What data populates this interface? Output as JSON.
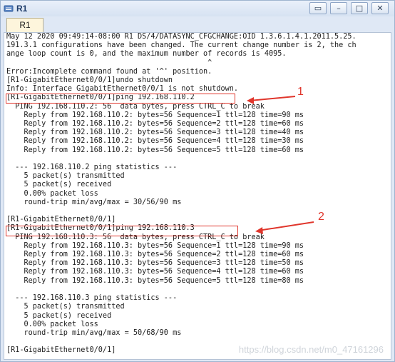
{
  "window": {
    "title": "R1",
    "controls": [
      "▭",
      "–",
      "□",
      "✕"
    ],
    "tab_label": "R1"
  },
  "terminal": {
    "lines": [
      "May 12 2020 09:49:14-08:00 R1 DS/4/DATASYNC_CFGCHANGE:OID 1.3.6.1.4.1.2011.5.25.",
      "191.3.1 configurations have been changed. The current change number is 2, the ch",
      "ange loop count is 0, and the maximum number of records is 4095.",
      "                                              ^",
      "Error:Incomplete command found at '^' position.",
      "[R1-GigabitEthernet0/0/1]undo shutdown",
      "Info: Interface GigabitEthernet0/0/1 is not shutdown.",
      "[R1-GigabitEthernet0/0/1]ping 192.168.110.2",
      "  PING 192.168.110.2: 56  data bytes, press CTRL_C to break",
      "    Reply from 192.168.110.2: bytes=56 Sequence=1 ttl=128 time=90 ms",
      "    Reply from 192.168.110.2: bytes=56 Sequence=2 ttl=128 time=60 ms",
      "    Reply from 192.168.110.2: bytes=56 Sequence=3 ttl=128 time=40 ms",
      "    Reply from 192.168.110.2: bytes=56 Sequence=4 ttl=128 time=30 ms",
      "    Reply from 192.168.110.2: bytes=56 Sequence=5 ttl=128 time=60 ms",
      "",
      "  --- 192.168.110.2 ping statistics ---",
      "    5 packet(s) transmitted",
      "    5 packet(s) received",
      "    0.00% packet loss",
      "    round-trip min/avg/max = 30/56/90 ms",
      "",
      "[R1-GigabitEthernet0/0/1]",
      "[R1-GigabitEthernet0/0/1]ping 192.168.110.3",
      "  PING 192.168.110.3: 56  data bytes, press CTRL_C to break",
      "    Reply from 192.168.110.3: bytes=56 Sequence=1 ttl=128 time=90 ms",
      "    Reply from 192.168.110.3: bytes=56 Sequence=2 ttl=128 time=60 ms",
      "    Reply from 192.168.110.3: bytes=56 Sequence=3 ttl=128 time=50 ms",
      "    Reply from 192.168.110.3: bytes=56 Sequence=4 ttl=128 time=60 ms",
      "    Reply from 192.168.110.3: bytes=56 Sequence=5 ttl=128 time=80 ms",
      "",
      "  --- 192.168.110.3 ping statistics ---",
      "    5 packet(s) transmitted",
      "    5 packet(s) received",
      "    0.00% packet loss",
      "    round-trip min/avg/max = 50/68/90 ms",
      "",
      "[R1-GigabitEthernet0/0/1]"
    ]
  },
  "annotations": {
    "label_1": "1",
    "label_2": "2",
    "accent_color": "#e0362c"
  },
  "watermark": "https://blog.csdn.net/m0_47161296"
}
